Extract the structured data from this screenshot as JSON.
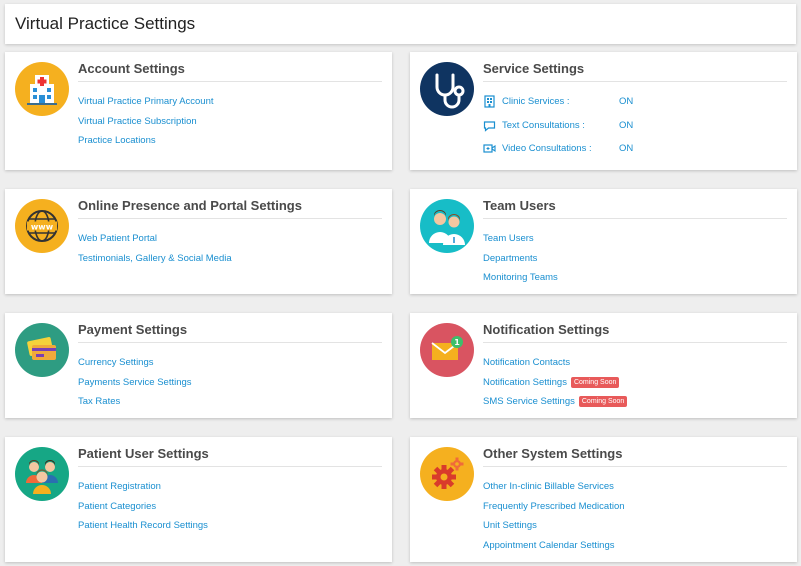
{
  "page": {
    "title": "Virtual Practice Settings"
  },
  "cards": {
    "account": {
      "title": "Account Settings",
      "icon": "hospital-icon",
      "links": [
        "Virtual Practice Primary Account",
        "Virtual Practice Subscription",
        "Practice Locations"
      ]
    },
    "service": {
      "title": "Service Settings",
      "icon": "stethoscope-icon",
      "rows": [
        {
          "label": "Clinic Services :",
          "value": "ON",
          "icon": "building-icon"
        },
        {
          "label": "Text Consultations :",
          "value": "ON",
          "icon": "chat-icon"
        },
        {
          "label": "Video Consultations :",
          "value": "ON",
          "icon": "video-icon"
        }
      ]
    },
    "online": {
      "title": "Online Presence and Portal Settings",
      "icon": "globe-www-icon",
      "links": [
        "Web Patient Portal",
        "Testimonials, Gallery & Social Media"
      ]
    },
    "team": {
      "title": "Team Users",
      "icon": "doctors-icon",
      "links": [
        "Team Users",
        "Departments",
        "Monitoring Teams"
      ]
    },
    "payment": {
      "title": "Payment Settings",
      "icon": "card-payment-icon",
      "links": [
        "Currency Settings",
        "Payments Service Settings",
        "Tax Rates"
      ]
    },
    "notification": {
      "title": "Notification Settings",
      "icon": "mail-notification-icon",
      "links": [
        "Notification Contacts",
        "Notification Settings",
        "SMS Service Settings"
      ],
      "badges": [
        "",
        "Coming Soon",
        "Coming Soon"
      ]
    },
    "patient": {
      "title": "Patient User Settings",
      "icon": "patients-icon",
      "links": [
        "Patient Registration",
        "Patient Categories",
        "Patient Health Record Settings"
      ]
    },
    "other": {
      "title": "Other System Settings",
      "icon": "gears-icon",
      "links": [
        "Other In-clinic Billable Services",
        "Frequently Prescribed Medication",
        "Unit Settings",
        "Appointment Calendar Settings"
      ]
    }
  },
  "colors": {
    "link": "#1a8fd0",
    "badge": "#e85a5a",
    "account_icon_bg": "#f5b01f",
    "service_icon_bg": "#0f3461",
    "online_icon_bg": "#f5b01f",
    "team_icon_bg": "#17bdc7",
    "payment_icon_bg": "#2e9c82",
    "notification_icon_bg": "#d95461",
    "patient_icon_bg": "#16a785",
    "other_icon_bg": "#f5b01f"
  }
}
